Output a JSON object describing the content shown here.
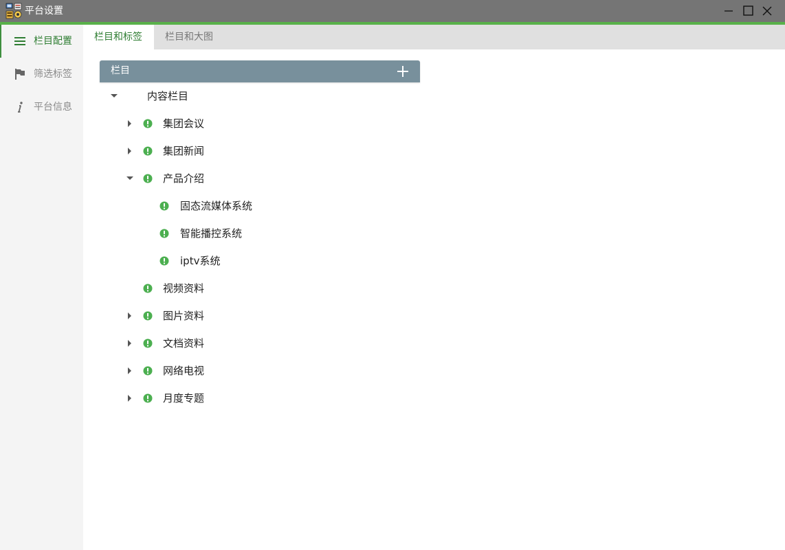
{
  "window": {
    "title": "平台设置"
  },
  "sidebar": {
    "items": [
      {
        "label": "栏目配置"
      },
      {
        "label": "筛选标签"
      },
      {
        "label": "平台信息"
      }
    ]
  },
  "tabs": [
    {
      "label": "栏目和标签"
    },
    {
      "label": "栏目和大图"
    }
  ],
  "panel": {
    "title": "栏目"
  },
  "tree": {
    "root": "内容栏目",
    "nodes": [
      {
        "label": "集团会议"
      },
      {
        "label": "集团新闻"
      },
      {
        "label": "产品介绍"
      },
      {
        "label": "固态流媒体系统"
      },
      {
        "label": "智能播控系统"
      },
      {
        "label": "iptv系统"
      },
      {
        "label": "视频资料"
      },
      {
        "label": "图片资料"
      },
      {
        "label": "文档资料"
      },
      {
        "label": "网络电视"
      },
      {
        "label": "月度专题"
      }
    ]
  },
  "colors": {
    "accent": "#59b14a",
    "active_text": "#2e7d32",
    "panel_header": "#78909c",
    "status_dot": "#4caf50",
    "titlebar": "#757575"
  }
}
